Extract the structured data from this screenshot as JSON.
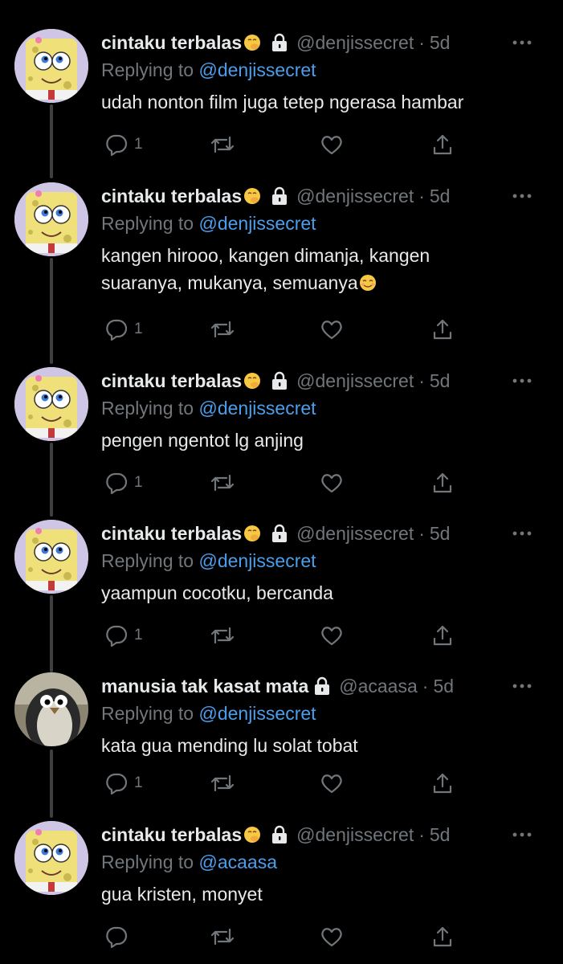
{
  "colors": {
    "background": "#000000",
    "text_primary": "#e7e9ea",
    "text_secondary": "#71767b",
    "mention": "#4c9eeb",
    "thread_line": "#3c4043"
  },
  "reply_prefix": "Replying to",
  "tweets": [
    {
      "display_name": "cintaku terbalas",
      "name_emoji": "face-with-hand-over-mouth-emoji",
      "protected": true,
      "handle": "@denjissecret",
      "dot": "·",
      "time": "5d",
      "avatar": "spongebob-avatar",
      "reply_to": "@denjissecret",
      "text": "udah nonton film juga tetep ngerasa hambar",
      "text_emoji": "",
      "reply_count": "1"
    },
    {
      "display_name": "cintaku terbalas",
      "name_emoji": "face-with-hand-over-mouth-emoji",
      "protected": true,
      "handle": "@denjissecret",
      "dot": "·",
      "time": "5d",
      "avatar": "spongebob-avatar",
      "reply_to": "@denjissecret",
      "text": "kangen hirooo, kangen dimanja, kangen\nsuaranya, mukanya, semuanya",
      "text_emoji": "smiling-face-emoji",
      "reply_count": "1"
    },
    {
      "display_name": "cintaku terbalas",
      "name_emoji": "face-with-hand-over-mouth-emoji",
      "protected": true,
      "handle": "@denjissecret",
      "dot": "·",
      "time": "5d",
      "avatar": "spongebob-avatar",
      "reply_to": "@denjissecret",
      "text": "pengen ngentot lg anjing",
      "text_emoji": "",
      "reply_count": "1"
    },
    {
      "display_name": "cintaku terbalas",
      "name_emoji": "face-with-hand-over-mouth-emoji",
      "protected": true,
      "handle": "@denjissecret",
      "dot": "·",
      "time": "5d",
      "avatar": "spongebob-avatar",
      "reply_to": "@denjissecret",
      "text": "yaampun cocotku, bercanda",
      "text_emoji": "",
      "reply_count": "1"
    },
    {
      "display_name": "manusia tak kasat mata",
      "name_emoji": "",
      "protected": true,
      "handle": "@acaasa",
      "dot": "·",
      "time": "5d",
      "avatar": "penguin-avatar",
      "reply_to": "@denjissecret",
      "text": "kata gua mending lu solat tobat",
      "text_emoji": "",
      "reply_count": "1"
    },
    {
      "display_name": "cintaku terbalas",
      "name_emoji": "face-with-hand-over-mouth-emoji",
      "protected": true,
      "handle": "@denjissecret",
      "dot": "·",
      "time": "5d",
      "avatar": "spongebob-avatar",
      "reply_to": "@acaasa",
      "text": "gua kristen, monyet",
      "text_emoji": "",
      "reply_count": ""
    }
  ]
}
